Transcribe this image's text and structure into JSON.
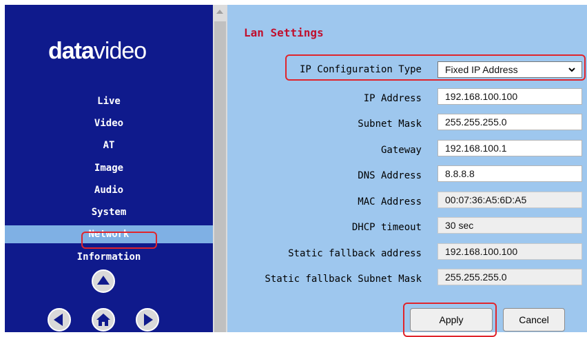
{
  "logo": {
    "part1": "data",
    "part2": "video"
  },
  "sidebar": {
    "items": [
      {
        "label": "Live"
      },
      {
        "label": "Video"
      },
      {
        "label": "AT"
      },
      {
        "label": "Image"
      },
      {
        "label": "Audio"
      },
      {
        "label": "System"
      },
      {
        "label": "Network",
        "active": true
      },
      {
        "label": "Information"
      }
    ],
    "controls": [
      "up-arrow-icon",
      "left-arrow-icon",
      "home-icon",
      "right-arrow-icon"
    ]
  },
  "main": {
    "title": "Lan Settings",
    "rows": [
      {
        "label": "IP Configuration Type",
        "value": "Fixed IP Address",
        "type": "select"
      },
      {
        "label": "IP Address",
        "value": "192.168.100.100",
        "type": "input"
      },
      {
        "label": "Subnet Mask",
        "value": "255.255.255.0",
        "type": "input"
      },
      {
        "label": "Gateway",
        "value": "192.168.100.1",
        "type": "input"
      },
      {
        "label": "DNS Address",
        "value": "8.8.8.8",
        "type": "input"
      },
      {
        "label": "MAC Address",
        "value": "00:07:36:A5:6D:A5",
        "type": "readonly"
      },
      {
        "label": "DHCP timeout",
        "value": "30 sec",
        "type": "readonly"
      },
      {
        "label": "Static fallback address",
        "value": "192.168.100.100",
        "type": "readonly"
      },
      {
        "label": "Static fallback Subnet Mask",
        "value": "255.255.255.0",
        "type": "readonly"
      }
    ],
    "buttons": {
      "apply": "Apply",
      "cancel": "Cancel"
    }
  },
  "colors": {
    "sidebar_bg": "#0f1a8c",
    "active_nav_bg": "#7fb0e4",
    "main_bg": "#9ec7ee",
    "title_color": "#c0102e",
    "highlight_border": "#e0242b"
  }
}
